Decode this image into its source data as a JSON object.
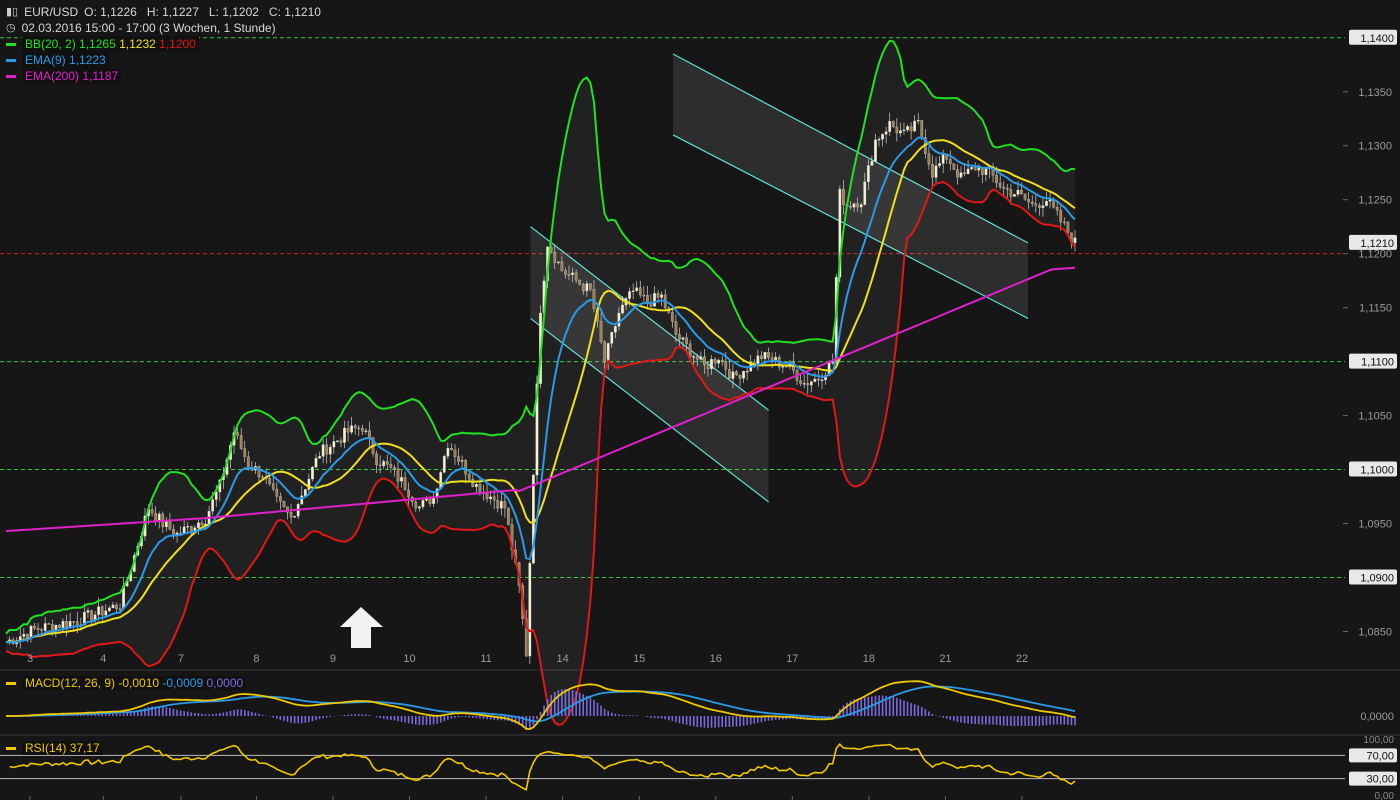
{
  "header": {
    "symbol": "EUR/USD",
    "ohlc": "O: 1,1226   H: 1,1227   L: 1,1202   C: 1,1210",
    "period": "02.03.2016 15:00 - 17:00 (3 Wochen, 1 Stunde)"
  },
  "legend": {
    "bb": {
      "label": "BB(20, 2)",
      "upper": "1,1265",
      "mid": "1,1232",
      "lower": "1,1200"
    },
    "ema9": {
      "label": "EMA(9)",
      "value": "1,1223"
    },
    "ema200": {
      "label": "EMA(200)",
      "value": "1,1187"
    }
  },
  "macd_legend": {
    "label": "MACD(12, 26, 9)",
    "macd": "-0,0010",
    "signal": "-0,0009",
    "hist": "0,0000"
  },
  "rsi_legend": {
    "label": "RSI(14)",
    "value": "37,17"
  },
  "colors": {
    "bg": "#161616",
    "bb_upper": "#22e022",
    "bb_mid": "#f0e020",
    "bb_lower": "#e01818",
    "ema9": "#2a9ae8",
    "ema200": "#e020c8",
    "grid_green": "#2ec82e",
    "grid_red": "#d02020",
    "channel": "#5fe0d8",
    "macd_hist": "#7a6ae0",
    "rsi": "#f0c800"
  },
  "chart_data": {
    "type": "candlestick",
    "instrument": "EUR/USD",
    "ylim": [
      1.0818,
      1.1435
    ],
    "y_ticks": [
      "1,1400",
      "1,1350",
      "1,1300",
      "1,1250",
      "1,1210",
      "1,1200",
      "1,1150",
      "1,1100",
      "1,1050",
      "1,1000",
      "1,0950",
      "1,0900",
      "1,0850"
    ],
    "y_tick_values": [
      1.14,
      1.135,
      1.13,
      1.125,
      1.121,
      1.12,
      1.115,
      1.11,
      1.105,
      1.1,
      1.095,
      1.09,
      1.085
    ],
    "highlighted_ticks": [
      "1,1400",
      "1,1210",
      "1,1100",
      "1,1000",
      "1,0900"
    ],
    "x_ticks": [
      "3",
      "4",
      "7",
      "8",
      "9",
      "10",
      "11",
      "14",
      "15",
      "16",
      "17",
      "18",
      "21",
      "22"
    ],
    "close_series": [
      [
        0,
        1.084
      ],
      [
        2,
        1.0852
      ],
      [
        5,
        1.086
      ],
      [
        8,
        1.0875
      ],
      [
        9,
        1.092
      ],
      [
        10,
        1.0965
      ],
      [
        11,
        1.095
      ],
      [
        12,
        1.094
      ],
      [
        14,
        1.0955
      ],
      [
        15,
        1.0985
      ],
      [
        16,
        1.1035
      ],
      [
        17,
        1.1005
      ],
      [
        18,
        1.0995
      ],
      [
        19,
        1.097
      ],
      [
        20,
        1.0955
      ],
      [
        21,
        1.0985
      ],
      [
        22,
        1.1015
      ],
      [
        23,
        1.1025
      ],
      [
        24,
        1.1035
      ],
      [
        25,
        1.104
      ],
      [
        26,
        1.101
      ],
      [
        27,
        1.1
      ],
      [
        28,
        1.0985
      ],
      [
        29,
        1.0965
      ],
      [
        30,
        1.0975
      ],
      [
        31,
        1.1025
      ],
      [
        32,
        1.1005
      ],
      [
        33,
        1.0985
      ],
      [
        34,
        1.0975
      ],
      [
        35,
        1.0965
      ],
      [
        36,
        1.089
      ],
      [
        36.5,
        1.083
      ],
      [
        37,
        1.1
      ],
      [
        37.5,
        1.115
      ],
      [
        38,
        1.121
      ],
      [
        39,
        1.1185
      ],
      [
        40,
        1.1175
      ],
      [
        41,
        1.1165
      ],
      [
        42,
        1.11
      ],
      [
        43,
        1.1145
      ],
      [
        44,
        1.1165
      ],
      [
        45,
        1.1155
      ],
      [
        46,
        1.116
      ],
      [
        47,
        1.1125
      ],
      [
        48,
        1.111
      ],
      [
        49,
        1.1095
      ],
      [
        50,
        1.1105
      ],
      [
        51,
        1.1085
      ],
      [
        52,
        1.1095
      ],
      [
        53,
        1.1105
      ],
      [
        54,
        1.11
      ],
      [
        55,
        1.1095
      ],
      [
        56,
        1.108
      ],
      [
        57,
        1.1085
      ],
      [
        58,
        1.11
      ],
      [
        58.5,
        1.1255
      ],
      [
        59,
        1.1245
      ],
      [
        60,
        1.125
      ],
      [
        61,
        1.1305
      ],
      [
        62,
        1.132
      ],
      [
        63,
        1.131
      ],
      [
        64,
        1.132
      ],
      [
        65,
        1.1275
      ],
      [
        66,
        1.129
      ],
      [
        67,
        1.127
      ],
      [
        68,
        1.128
      ],
      [
        69,
        1.1275
      ],
      [
        70,
        1.126
      ],
      [
        71,
        1.1255
      ],
      [
        72,
        1.1245
      ],
      [
        73,
        1.125
      ],
      [
        74,
        1.123
      ],
      [
        75,
        1.121
      ]
    ],
    "series": [
      {
        "name": "BB(20, 2)",
        "values": [
          1.1265,
          1.1232,
          1.12
        ]
      },
      {
        "name": "EMA(9)",
        "value": 1.1223
      },
      {
        "name": "EMA(200)",
        "value": 1.1187
      }
    ],
    "macd_ticks": [
      "0,0000"
    ],
    "rsi_ticks": [
      "100,00",
      "70,00",
      "30,00",
      "0,00"
    ],
    "rsi_last": 37.17,
    "macd_last": {
      "macd": -0.001,
      "signal": -0.0009,
      "hist": 0.0
    }
  }
}
